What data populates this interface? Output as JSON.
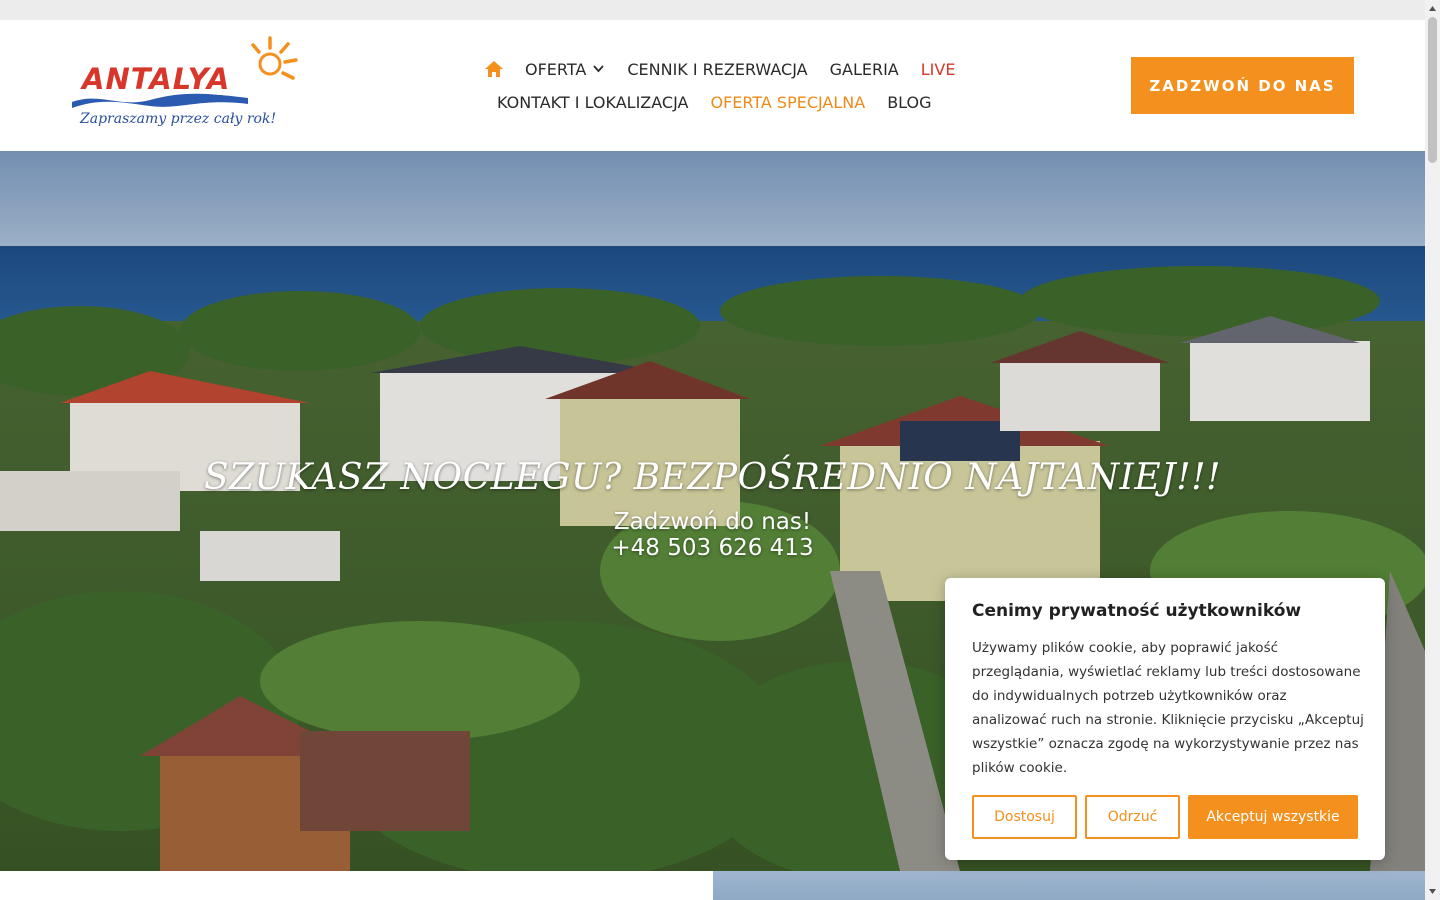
{
  "logo": {
    "word": "ANTALYA",
    "tagline": "Zapraszamy przez cały rok!"
  },
  "nav": {
    "home_icon": "home-icon",
    "items_row1": [
      {
        "label": "OFERTA",
        "has_dropdown": true
      },
      {
        "label": "CENNIK I REZERWACJA"
      },
      {
        "label": "GALERIA"
      },
      {
        "label": "LIVE",
        "color": "#d9362b"
      }
    ],
    "items_row2": [
      {
        "label": "KONTAKT I LOKALIZACJA"
      },
      {
        "label": "OFERTA SPECJALNA",
        "color": "#ef8a1a"
      },
      {
        "label": "BLOG"
      }
    ]
  },
  "cta": {
    "label": "ZADZWOŃ DO NAS"
  },
  "hero": {
    "title": "SZUKASZ NOCLEGU? BEZPOŚREDNIO NAJTANIEJ!!!",
    "subtitle": "Zadzwoń do nas!",
    "phone": "+48 503 626 413"
  },
  "cookie": {
    "title": "Cenimy prywatność użytkowników",
    "text": "Używamy plików cookie, aby poprawić jakość przeglądania, wyświetlać reklamy lub treści dostosowane do indywidualnych potrzeb użytkowników oraz analizować ruch na stronie. Kliknięcie przycisku „Akceptuj wszystkie” oznacza zgodę na wykorzystywanie przez nas plików cookie.",
    "btn_customize": "Dostosuj",
    "btn_reject": "Odrzuć",
    "btn_accept": "Akceptuj wszystkie"
  },
  "colors": {
    "accent": "#f4901e",
    "live": "#d9362b",
    "special": "#ef8a1a"
  }
}
